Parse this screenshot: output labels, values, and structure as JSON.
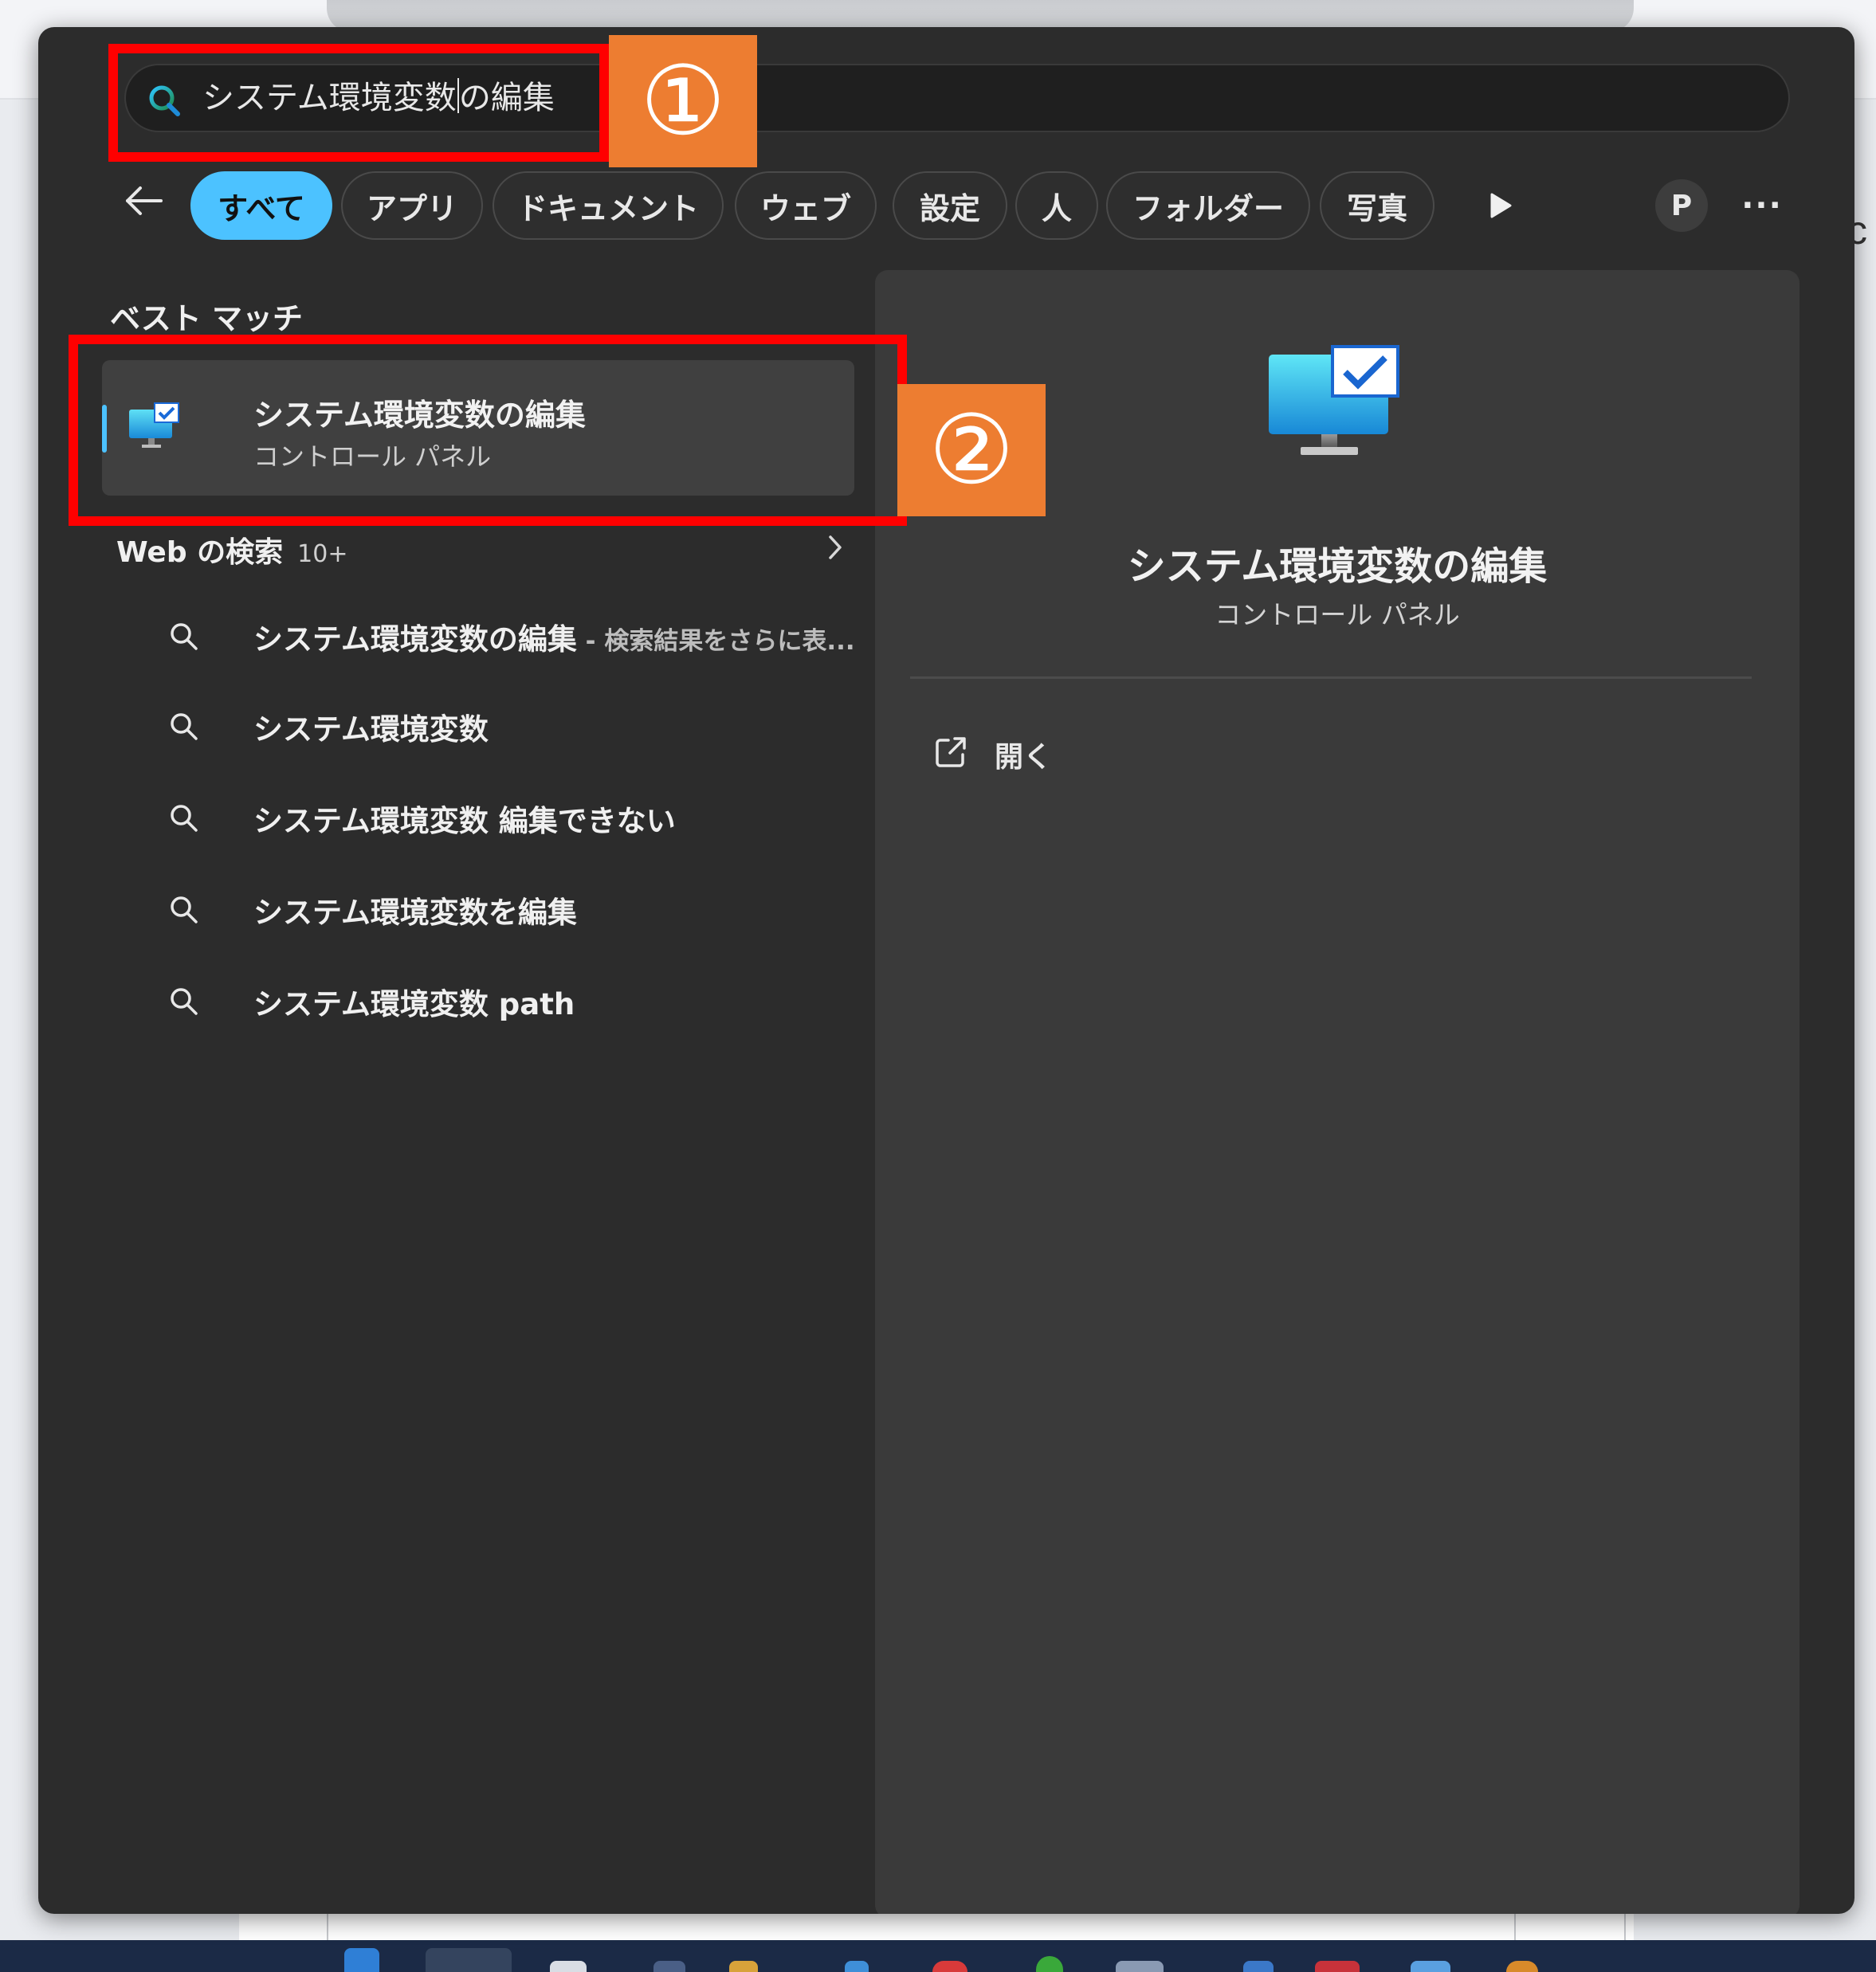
{
  "search": {
    "query_before_caret": "システム環境変数",
    "query_after_caret": "の編集"
  },
  "filters": [
    {
      "label": "すべて",
      "active": true
    },
    {
      "label": "アプリ",
      "active": false
    },
    {
      "label": "ドキュメント",
      "active": false
    },
    {
      "label": "ウェブ",
      "active": false
    },
    {
      "label": "設定",
      "active": false
    },
    {
      "label": "人",
      "active": false
    },
    {
      "label": "フォルダー",
      "active": false
    },
    {
      "label": "写真",
      "active": false
    }
  ],
  "account": {
    "initial": "P"
  },
  "more_label": "···",
  "best_match": {
    "heading": "ベスト マッチ",
    "title": "システム環境変数の編集",
    "subtitle": "コントロール パネル"
  },
  "web": {
    "heading": "Web の検索",
    "count": "10+",
    "suggestions": [
      {
        "text": "システム環境変数の編集",
        "hint": " - 検索結果をさらに表..."
      },
      {
        "text": "システム環境変数",
        "hint": ""
      },
      {
        "text": "システム環境変数 編集できない",
        "hint": ""
      },
      {
        "text": "システム環境変数を編集",
        "hint": ""
      },
      {
        "text": "システム環境変数 path",
        "hint": ""
      }
    ]
  },
  "detail": {
    "title": "システム環境変数の編集",
    "subtitle": "コントロール パネル",
    "open_label": "開く"
  },
  "annotations": {
    "step1": "①",
    "step2": "②"
  },
  "background": {
    "edge_text": "c"
  },
  "colors": {
    "accent": "#4cc2ff",
    "panel": "#2c2c2c",
    "annotation_box": "#ff0000",
    "annotation_badge": "#ed7d31"
  }
}
